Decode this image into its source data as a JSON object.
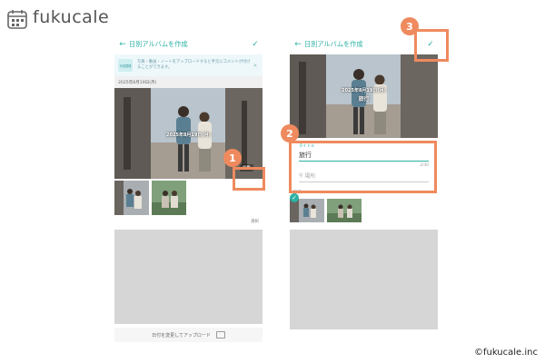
{
  "logo": {
    "text": "fukucale"
  },
  "left_screen": {
    "back_icon": "←",
    "title": "日別アルバムを作成",
    "check_icon": "✓",
    "tip": {
      "icon_label": "写真整理",
      "text": "写真・動画・ノートをアップロードすると手元にコメントが付けることができます。",
      "close_icon": "×"
    },
    "date_header": "2025年8月19日(月)",
    "photo_caption": "2025年8月19日(月)",
    "edit_label": "編集",
    "select_label": "選択",
    "bottom_action": "日付を変更してアップロード"
  },
  "right_screen": {
    "back_icon": "←",
    "title": "日別アルバムを作成",
    "check_icon": "✓",
    "photo_date": "2025年8月19日(月)",
    "photo_title": "旅行",
    "title_field_label": "タイトル",
    "title_value": "旅行",
    "title_counter": "2/30",
    "place_placeholder": "場所",
    "photos_label": "写真"
  },
  "badges": {
    "one": "1",
    "two": "2",
    "three": "3"
  },
  "copyright": "©fukucale.inc",
  "colors": {
    "accent": "#2bb1a3",
    "highlight": "#ef8a5e"
  }
}
